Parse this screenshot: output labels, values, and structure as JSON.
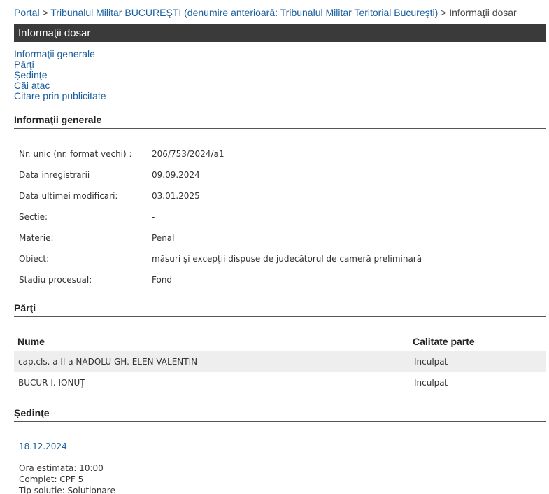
{
  "breadcrumb": {
    "items": [
      "Portal",
      "Tribunalul Militar BUCUREŞTI (denumire anterioară: Tribunalul Militar Teritorial Bucureşti)"
    ],
    "separator": ">",
    "current": "Informaţii dosar"
  },
  "page_title": "Informaţii dosar",
  "nav_links": [
    "Informaţii generale",
    "Părţi",
    "Şedinţe",
    "Căi atac",
    "Citare prin publicitate"
  ],
  "general": {
    "section_title": "Informaţii generale",
    "rows": [
      {
        "label": "Nr. unic (nr. format vechi) :",
        "value": "206/753/2024/a1"
      },
      {
        "label": "Data inregistrarii",
        "value": "09.09.2024"
      },
      {
        "label": "Data ultimei modificari:",
        "value": "03.01.2025"
      },
      {
        "label": "Sectie:",
        "value": "-"
      },
      {
        "label": "Materie:",
        "value": "Penal"
      },
      {
        "label": "Obiect:",
        "value": "măsuri şi excepţii dispuse de judecătorul de cameră preliminară"
      },
      {
        "label": "Stadiu procesual:",
        "value": "Fond"
      }
    ]
  },
  "parti": {
    "section_title": "Părţi",
    "headers": {
      "name": "Nume",
      "role": "Calitate parte"
    },
    "rows": [
      {
        "name": "cap.cls. a II a NADOLU GH. ELEN VALENTIN",
        "role": "Inculpat"
      },
      {
        "name": "BUCUR I. IONUŢ",
        "role": "Inculpat"
      }
    ]
  },
  "sedinte": {
    "section_title": "Şedinţe",
    "date": "18.12.2024",
    "details": [
      "Ora estimata: 10:00",
      "Complet: CPF 5",
      "Tip solutie: Solutionare"
    ]
  }
}
